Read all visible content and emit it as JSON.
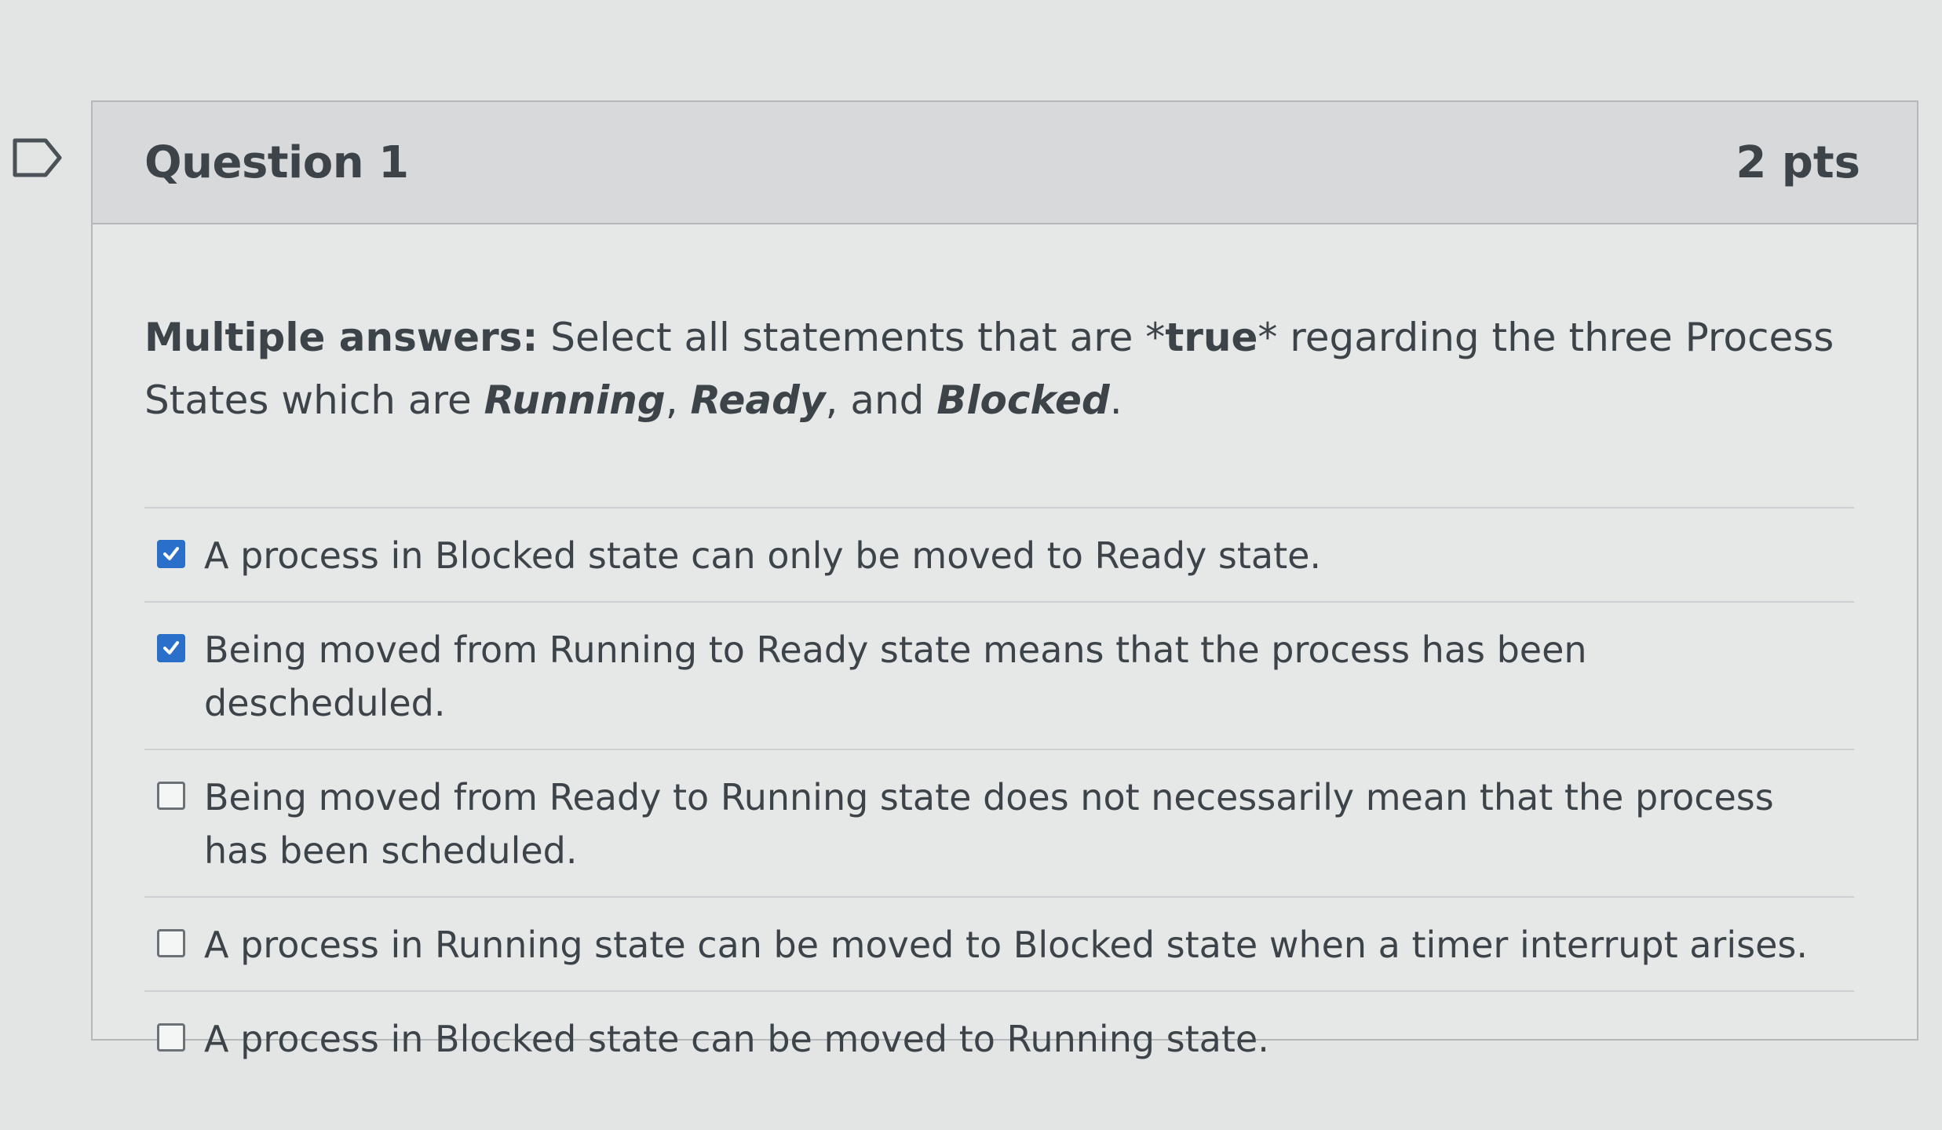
{
  "question": {
    "title": "Question 1",
    "points": "2 pts",
    "prompt_parts": [
      {
        "text": "Multiple answers:",
        "style": "bold"
      },
      {
        "text": " Select all statements that are *",
        "style": "normal"
      },
      {
        "text": "true",
        "style": "bold"
      },
      {
        "text": "* regarding the three Process States which are ",
        "style": "normal"
      },
      {
        "text": "Running",
        "style": "bold-italic"
      },
      {
        "text": ", ",
        "style": "normal"
      },
      {
        "text": "Ready",
        "style": "bold-italic"
      },
      {
        "text": ", and ",
        "style": "normal"
      },
      {
        "text": "Blocked",
        "style": "bold-italic"
      },
      {
        "text": ".",
        "style": "normal"
      }
    ]
  },
  "answers": [
    {
      "label": "A process in Blocked state can only be moved to Ready state.",
      "checked": true
    },
    {
      "label": "Being moved from Running to Ready state means that the process has been descheduled.",
      "checked": true
    },
    {
      "label": "Being moved from Ready to Running state does not necessarily mean that the process has been scheduled.",
      "checked": false
    },
    {
      "label": "A process in Running state can be moved to Blocked state when a timer interrupt arises.",
      "checked": false
    },
    {
      "label": "A process in Blocked state can be moved to Running state.",
      "checked": false
    }
  ],
  "colors": {
    "checkbox_checked": "#2a6fc9",
    "text": "#3d4449",
    "header_bg": "#d8d9da"
  },
  "icons": {
    "flag": "flag-outline-icon",
    "check": "check-mark-icon"
  }
}
